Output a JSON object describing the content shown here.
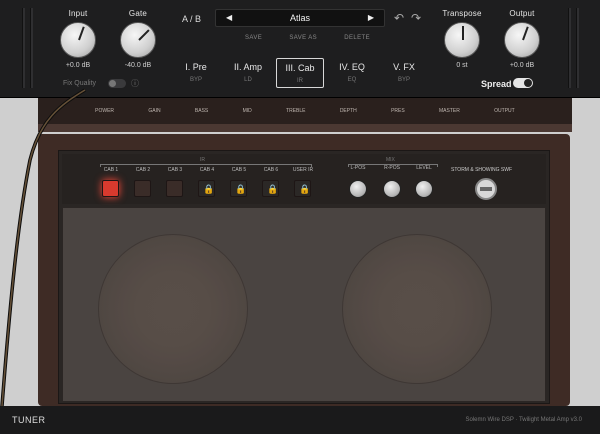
{
  "header": {
    "input": {
      "label": "Input",
      "value": "+0.0 dB"
    },
    "gate": {
      "label": "Gate",
      "value": "-40.0 dB"
    },
    "ab_label": "A / B",
    "preset": {
      "prev": "◀",
      "name": "Atlas",
      "next": "▶"
    },
    "preset_actions": [
      "SAVE",
      "SAVE AS",
      "DELETE"
    ],
    "transpose": {
      "label": "Transpose",
      "value": "0 st"
    },
    "output": {
      "label": "Output",
      "value": "+0.0 dB"
    },
    "modules": [
      {
        "name": "I. Pre",
        "sub": "BYP"
      },
      {
        "name": "II. Amp",
        "sub": "LD"
      },
      {
        "name": "III. Cab",
        "sub": "IR"
      },
      {
        "name": "IV. EQ",
        "sub": "EQ"
      },
      {
        "name": "V. FX",
        "sub": "BYP"
      }
    ],
    "fix_quality_label": "Fix Quality",
    "spread_label": "Spread"
  },
  "amp_head": {
    "labels": [
      "POWER",
      "GAIN",
      "BASS",
      "MID",
      "TREBLE",
      "DEPTH",
      "PRES",
      "MASTER",
      "OUTPUT"
    ]
  },
  "cab": {
    "buttons": [
      {
        "label": "CAB 1",
        "state": "active"
      },
      {
        "label": "CAB 2",
        "state": "off"
      },
      {
        "label": "CAB 3",
        "state": "off"
      },
      {
        "label": "CAB 4",
        "state": "locked"
      },
      {
        "label": "CAB 5",
        "state": "locked"
      },
      {
        "label": "CAB 6",
        "state": "locked"
      },
      {
        "label": "USER IR",
        "state": "locked"
      }
    ],
    "mic_knobs": [
      "L-POS",
      "R-POS",
      "LEVEL"
    ],
    "section_labels": [
      "IR",
      "MIX"
    ],
    "brand_label": "STORM & SHOWING SWF"
  },
  "footer": {
    "tuner": "TUNER",
    "info": "Solemn Wire DSP · Twilight Metal Amp v3.0"
  },
  "icons": {
    "undo": "↶",
    "redo": "↷",
    "lock": "🔒",
    "info": "ⓘ"
  }
}
